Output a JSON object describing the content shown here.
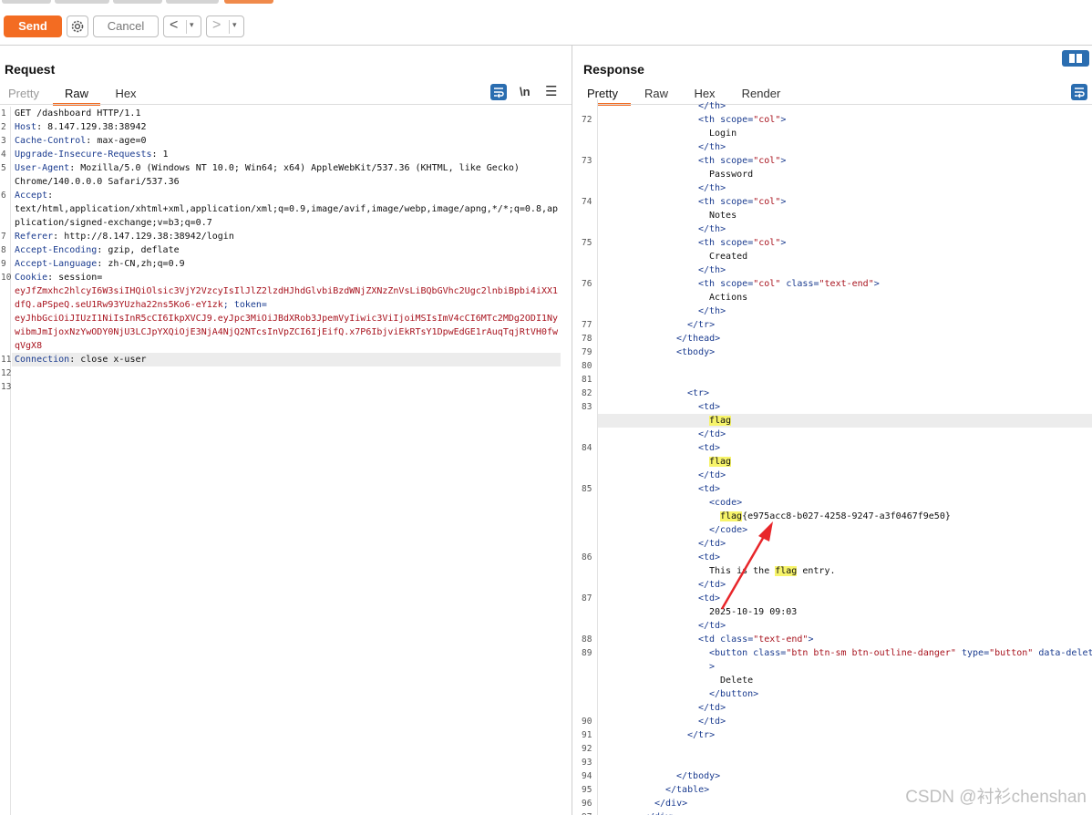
{
  "toolbar": {
    "send_label": "Send",
    "cancel_label": "Cancel",
    "back_glyph": "<",
    "forward_glyph": ">",
    "dropdown_glyph": "▾",
    "settings_icon": "gear-icon"
  },
  "request": {
    "title": "Request",
    "tabs": [
      "Pretty",
      "Raw",
      "Hex"
    ],
    "active_tab": "Raw",
    "newline_label": "\\n",
    "lines": [
      {
        "n": "1",
        "text": "GET /dashboard HTTP/1.1"
      },
      {
        "n": "2",
        "key": "Host",
        "val": ": 8.147.129.38:38942"
      },
      {
        "n": "3",
        "key": "Cache-Control",
        "val": ": max-age=0"
      },
      {
        "n": "4",
        "key": "Upgrade-Insecure-Requests",
        "val": ": 1"
      },
      {
        "n": "5",
        "key": "User-Agent",
        "val": ": Mozilla/5.0 (Windows NT 10.0; Win64; x64) AppleWebKit/537.36 (KHTML, like Gecko)"
      },
      {
        "n": "",
        "text": "Chrome/140.0.0.0 Safari/537.36"
      },
      {
        "n": "6",
        "key": "Accept",
        "val": ":"
      },
      {
        "n": "",
        "text": "text/html,application/xhtml+xml,application/xml;q=0.9,image/avif,image/webp,image/apng,*/*;q=0.8,ap"
      },
      {
        "n": "",
        "text": "plication/signed-exchange;v=b3;q=0.7"
      },
      {
        "n": "7",
        "key": "Referer",
        "val": ": http://8.147.129.38:38942/login"
      },
      {
        "n": "8",
        "key": "Accept-Encoding",
        "val": ": gzip, deflate"
      },
      {
        "n": "9",
        "key": "Accept-Language",
        "val": ": zh-CN,zh;q=0.9"
      },
      {
        "n": "10",
        "key": "Cookie",
        "val": ": session="
      },
      {
        "n": "",
        "red": "eyJfZmxhc2hlcyI6W3siIHQiOlsic3VjY2VzcyIsIlJlZ2lzdHJhdGlvbiBzdWNjZXNzZnVsLiBQbGVhc2Ugc2lnbiBpbi4iXX1"
      },
      {
        "n": "",
        "red": "dfQ.aPSpeQ.seU1Rw93YUzha22ns5Ko6-eY1zk",
        "tail": "; token="
      },
      {
        "n": "",
        "red": "eyJhbGciOiJIUzI1NiIsInR5cCI6IkpXVCJ9.eyJpc3MiOiJBdXRob3JpemVyIiwic3ViIjoiMSIsImV4cCI6MTc2MDg2ODI1Ny"
      },
      {
        "n": "",
        "red": "wibmJmIjoxNzYwODY0NjU3LCJpYXQiOjE3NjA4NjQ2NTcsInVpZCI6IjEifQ.x7P6IbjviEkRTsY1DpwEdGE1rAuqTqjRtVH0fw"
      },
      {
        "n": "",
        "red": "qVgX8"
      },
      {
        "n": "11",
        "key": "Connection",
        "val": ": close x-user"
      },
      {
        "n": "12",
        "text": ""
      },
      {
        "n": "13",
        "text": ""
      }
    ]
  },
  "response": {
    "title": "Response",
    "tabs": [
      "Pretty",
      "Raw",
      "Hex",
      "Render"
    ],
    "active_tab": "Pretty",
    "lines": [
      {
        "n": "",
        "ind": 9,
        "parts": [
          [
            "tag",
            "</th>"
          ]
        ]
      },
      {
        "n": "72",
        "ind": 9,
        "parts": [
          [
            "tag",
            "<th "
          ],
          [
            "attr",
            "scope"
          ],
          [
            "tag",
            "="
          ],
          [
            "str",
            "\"col\""
          ],
          [
            "tag",
            ">"
          ]
        ]
      },
      {
        "n": "",
        "ind": 10,
        "parts": [
          [
            "v",
            "Login"
          ]
        ]
      },
      {
        "n": "",
        "ind": 9,
        "parts": [
          [
            "tag",
            "</th>"
          ]
        ]
      },
      {
        "n": "73",
        "ind": 9,
        "parts": [
          [
            "tag",
            "<th "
          ],
          [
            "attr",
            "scope"
          ],
          [
            "tag",
            "="
          ],
          [
            "str",
            "\"col\""
          ],
          [
            "tag",
            ">"
          ]
        ]
      },
      {
        "n": "",
        "ind": 10,
        "parts": [
          [
            "v",
            "Password"
          ]
        ]
      },
      {
        "n": "",
        "ind": 9,
        "parts": [
          [
            "tag",
            "</th>"
          ]
        ]
      },
      {
        "n": "74",
        "ind": 9,
        "parts": [
          [
            "tag",
            "<th "
          ],
          [
            "attr",
            "scope"
          ],
          [
            "tag",
            "="
          ],
          [
            "str",
            "\"col\""
          ],
          [
            "tag",
            ">"
          ]
        ]
      },
      {
        "n": "",
        "ind": 10,
        "parts": [
          [
            "v",
            "Notes"
          ]
        ]
      },
      {
        "n": "",
        "ind": 9,
        "parts": [
          [
            "tag",
            "</th>"
          ]
        ]
      },
      {
        "n": "75",
        "ind": 9,
        "parts": [
          [
            "tag",
            "<th "
          ],
          [
            "attr",
            "scope"
          ],
          [
            "tag",
            "="
          ],
          [
            "str",
            "\"col\""
          ],
          [
            "tag",
            ">"
          ]
        ]
      },
      {
        "n": "",
        "ind": 10,
        "parts": [
          [
            "v",
            "Created"
          ]
        ]
      },
      {
        "n": "",
        "ind": 9,
        "parts": [
          [
            "tag",
            "</th>"
          ]
        ]
      },
      {
        "n": "76",
        "ind": 9,
        "parts": [
          [
            "tag",
            "<th "
          ],
          [
            "attr",
            "scope"
          ],
          [
            "tag",
            "="
          ],
          [
            "str",
            "\"col\""
          ],
          [
            "tag",
            " "
          ],
          [
            "attr",
            "class"
          ],
          [
            "tag",
            "="
          ],
          [
            "str",
            "\"text-end\""
          ],
          [
            "tag",
            ">"
          ]
        ]
      },
      {
        "n": "",
        "ind": 10,
        "parts": [
          [
            "v",
            "Actions"
          ]
        ]
      },
      {
        "n": "",
        "ind": 9,
        "parts": [
          [
            "tag",
            "</th>"
          ]
        ]
      },
      {
        "n": "77",
        "ind": 8,
        "parts": [
          [
            "tag",
            "</tr>"
          ]
        ]
      },
      {
        "n": "78",
        "ind": 7,
        "parts": [
          [
            "tag",
            "</thead>"
          ]
        ]
      },
      {
        "n": "79",
        "ind": 7,
        "parts": [
          [
            "tag",
            "<tbody>"
          ]
        ]
      },
      {
        "n": "80",
        "ind": 0,
        "parts": []
      },
      {
        "n": "81",
        "ind": 0,
        "parts": []
      },
      {
        "n": "82",
        "ind": 8,
        "parts": [
          [
            "tag",
            "<tr>"
          ]
        ]
      },
      {
        "n": "83",
        "ind": 9,
        "parts": [
          [
            "tag",
            "<td>"
          ]
        ]
      },
      {
        "n": "",
        "ind": 10,
        "rowhl": true,
        "parts": [
          [
            "hl",
            "flag"
          ]
        ]
      },
      {
        "n": "",
        "ind": 9,
        "parts": [
          [
            "tag",
            "</td>"
          ]
        ]
      },
      {
        "n": "84",
        "ind": 9,
        "parts": [
          [
            "tag",
            "<td>"
          ]
        ]
      },
      {
        "n": "",
        "ind": 10,
        "parts": [
          [
            "hl",
            "flag"
          ]
        ]
      },
      {
        "n": "",
        "ind": 9,
        "parts": [
          [
            "tag",
            "</td>"
          ]
        ]
      },
      {
        "n": "85",
        "ind": 9,
        "parts": [
          [
            "tag",
            "<td>"
          ]
        ]
      },
      {
        "n": "",
        "ind": 10,
        "parts": [
          [
            "tag",
            "<code>"
          ]
        ]
      },
      {
        "n": "",
        "ind": 11,
        "parts": [
          [
            "hl",
            "flag"
          ],
          [
            "v",
            "{e975acc8-b027-4258-9247-a3f0467f9e50}"
          ]
        ]
      },
      {
        "n": "",
        "ind": 10,
        "parts": [
          [
            "tag",
            "</code>"
          ]
        ]
      },
      {
        "n": "",
        "ind": 9,
        "parts": [
          [
            "tag",
            "</td>"
          ]
        ]
      },
      {
        "n": "86",
        "ind": 9,
        "parts": [
          [
            "tag",
            "<td>"
          ]
        ]
      },
      {
        "n": "",
        "ind": 10,
        "parts": [
          [
            "v",
            "This is the "
          ],
          [
            "hl",
            "flag"
          ],
          [
            "v",
            " entry."
          ]
        ]
      },
      {
        "n": "",
        "ind": 9,
        "parts": [
          [
            "tag",
            "</td>"
          ]
        ]
      },
      {
        "n": "87",
        "ind": 9,
        "parts": [
          [
            "tag",
            "<td>"
          ]
        ]
      },
      {
        "n": "",
        "ind": 10,
        "parts": [
          [
            "v",
            "2025-10-19 09:03"
          ]
        ]
      },
      {
        "n": "",
        "ind": 9,
        "parts": [
          [
            "tag",
            "</td>"
          ]
        ]
      },
      {
        "n": "88",
        "ind": 9,
        "parts": [
          [
            "tag",
            "<td "
          ],
          [
            "attr",
            "class"
          ],
          [
            "tag",
            "="
          ],
          [
            "str",
            "\"text-end\""
          ],
          [
            "tag",
            ">"
          ]
        ]
      },
      {
        "n": "89",
        "ind": 10,
        "parts": [
          [
            "tag",
            "<button "
          ],
          [
            "attr",
            "class"
          ],
          [
            "tag",
            "="
          ],
          [
            "str",
            "\"btn btn-sm btn-outline-danger\""
          ],
          [
            "tag",
            " "
          ],
          [
            "attr",
            "type"
          ],
          [
            "tag",
            "="
          ],
          [
            "str",
            "\"button\""
          ],
          [
            "tag",
            " "
          ],
          [
            "attr",
            "data-delet"
          ]
        ]
      },
      {
        "n": "",
        "ind": 10,
        "parts": [
          [
            "tag",
            ">"
          ]
        ]
      },
      {
        "n": "",
        "ind": 11,
        "parts": [
          [
            "v",
            "Delete"
          ]
        ]
      },
      {
        "n": "",
        "ind": 10,
        "parts": [
          [
            "tag",
            "</button>"
          ]
        ]
      },
      {
        "n": "",
        "ind": 9,
        "parts": [
          [
            "tag",
            "</td>"
          ]
        ]
      },
      {
        "n": "90",
        "ind": 9,
        "parts": [
          [
            "tag",
            "</td>"
          ]
        ]
      },
      {
        "n": "91",
        "ind": 8,
        "parts": [
          [
            "tag",
            "</tr>"
          ]
        ]
      },
      {
        "n": "92",
        "ind": 0,
        "parts": []
      },
      {
        "n": "93",
        "ind": 0,
        "parts": []
      },
      {
        "n": "94",
        "ind": 7,
        "parts": [
          [
            "tag",
            "</tbody>"
          ]
        ]
      },
      {
        "n": "95",
        "ind": 6,
        "parts": [
          [
            "tag",
            "</table>"
          ]
        ]
      },
      {
        "n": "96",
        "ind": 5,
        "parts": [
          [
            "tag",
            "</div>"
          ]
        ]
      },
      {
        "n": "97",
        "ind": 4,
        "parts": [
          [
            "tag",
            "</div>"
          ]
        ]
      },
      {
        "n": "98",
        "ind": 3,
        "parts": [
          [
            "tag",
            "</div>"
          ]
        ]
      }
    ]
  },
  "watermark": "CSDN @衬衫chenshan"
}
